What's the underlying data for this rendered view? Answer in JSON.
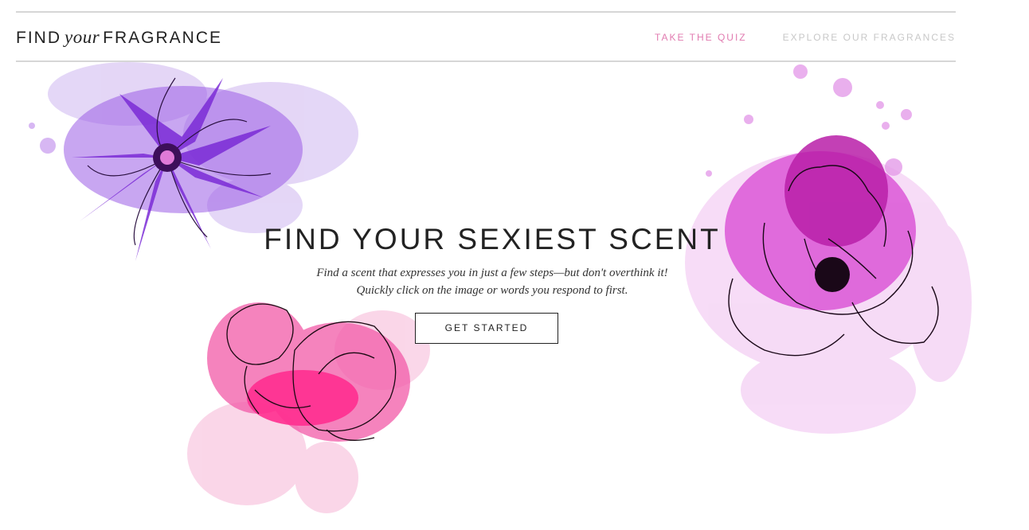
{
  "header": {
    "logo": {
      "part1": "FIND",
      "italic": "your",
      "part2": "FRAGRANCE"
    },
    "nav": [
      {
        "label": "TAKE THE QUIZ",
        "color": "#e17bb0"
      },
      {
        "label": "EXPLORE OUR FRAGRANCES",
        "color": "#c8c8c8"
      }
    ]
  },
  "hero": {
    "title": "FIND YOUR SEXIEST SCENT",
    "subtitle_line1": "Find a scent that expresses you in just a few steps—but don't overthink it!",
    "subtitle_line2": "Quickly click on the image or words you respond to first.",
    "cta_label": "GET STARTED"
  },
  "decor": {
    "flowers": [
      "purple-cornflower-illustration",
      "pink-rosebud-illustration",
      "magenta-poppy-illustration"
    ],
    "colors": {
      "purple": "#7b2bd6",
      "pink": "#f25aa8",
      "magenta": "#d63bd0"
    }
  }
}
